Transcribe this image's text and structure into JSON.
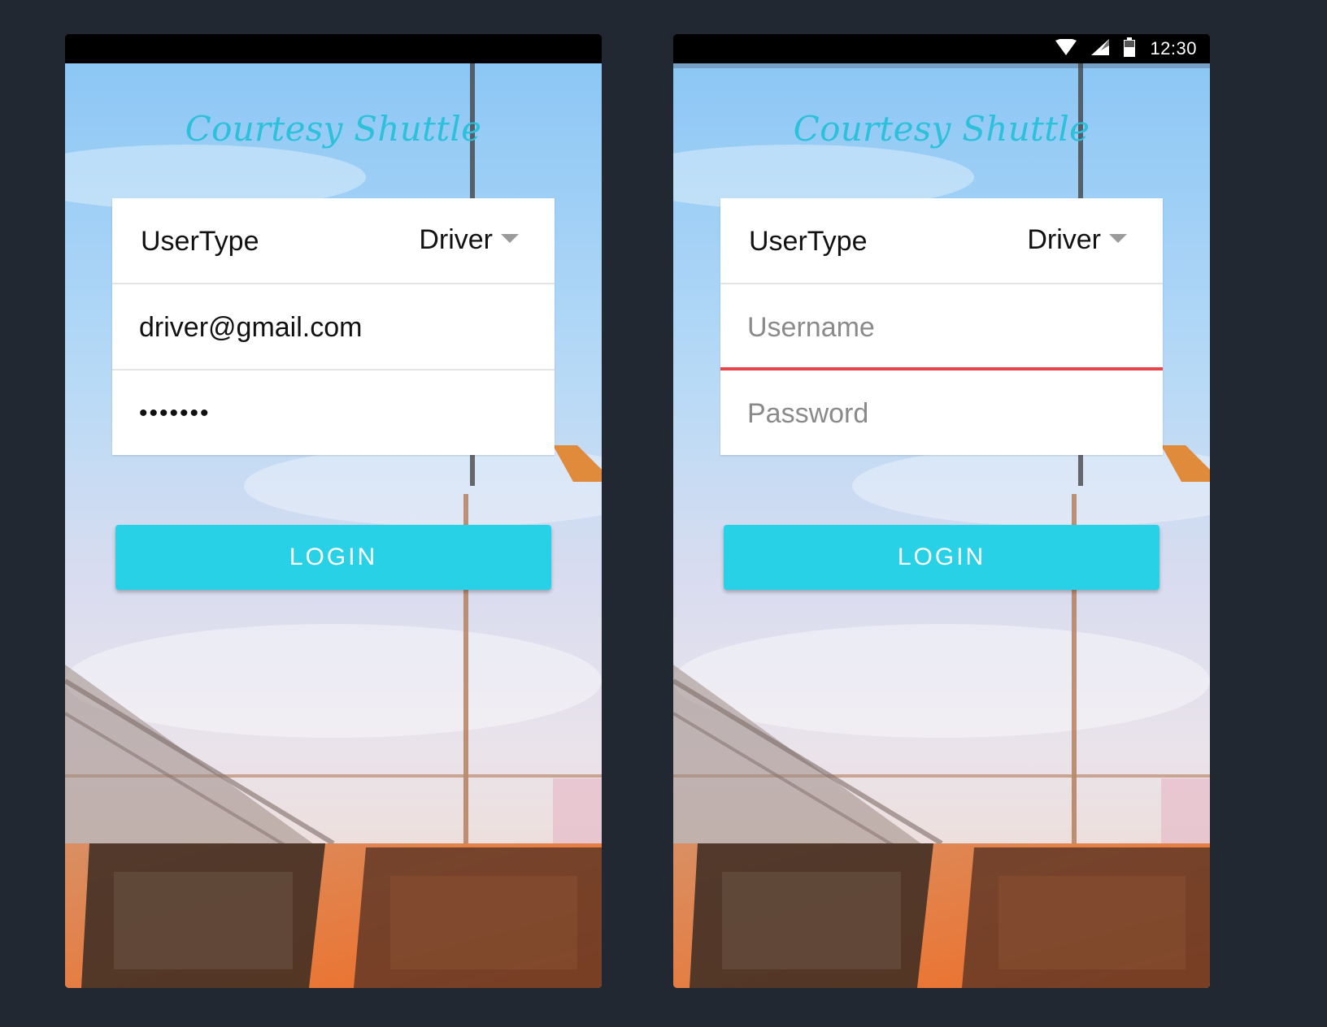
{
  "app": {
    "title": "Courtesy Shuttle",
    "accent_color": "#2cc0da",
    "button_color": "#29d1e6",
    "error_color": "#e8444b"
  },
  "screens": [
    {
      "status": {
        "time": ""
      },
      "form": {
        "usertype_label": "UserType",
        "usertype_value": "Driver",
        "username_value": "driver@gmail.com",
        "username_placeholder": "Username",
        "password_value": "•••••••",
        "password_placeholder": "Password"
      },
      "login_label": "LOGIN"
    },
    {
      "status": {
        "time": "12:30",
        "icons": [
          "wifi-icon",
          "signal-icon",
          "battery-icon"
        ]
      },
      "form": {
        "usertype_label": "UserType",
        "usertype_value": "Driver",
        "username_value": "",
        "username_placeholder": "Username",
        "password_value": "",
        "password_placeholder": "Password",
        "username_error": true
      },
      "login_label": "LOGIN"
    }
  ]
}
